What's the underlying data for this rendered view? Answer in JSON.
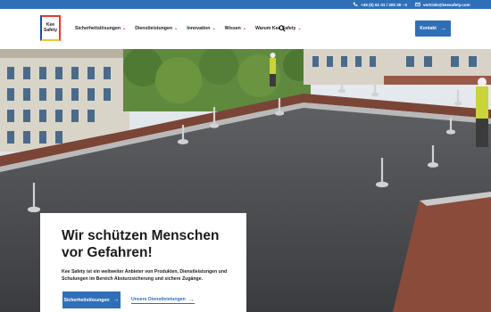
{
  "topbar": {
    "phone": "+49 (0) 61 01 / 300 30 - 0",
    "email": "vertrieb@keesafety.com",
    "phone_icon": "phone-icon",
    "mail_icon": "mail-icon"
  },
  "header": {
    "logo_text": "Kee\nSafety",
    "nav": [
      {
        "label": "Sicherheitslösungen"
      },
      {
        "label": "Dienstleistungen"
      },
      {
        "label": "Innovation"
      },
      {
        "label": "Wissen"
      },
      {
        "label": "Warum Kee Safety"
      }
    ],
    "search_icon": "search-icon",
    "contact_button": "Kontakt"
  },
  "hero": {
    "title": "Wir schützen Menschen vor Gefahren!",
    "description": "Kee Safety ist ein weltweiter Anbieter von Produkten, Dienstleistungen und Schulungen im Bereich Absturzsicherung und sichere Zugänge.",
    "primary_button": "Sicherheitslösungen",
    "secondary_link": "Unsere Dienstleistungen"
  },
  "colors": {
    "brand_blue": "#2f6fb7",
    "accent_red": "#d32b3a",
    "text": "#1b1b1b"
  }
}
